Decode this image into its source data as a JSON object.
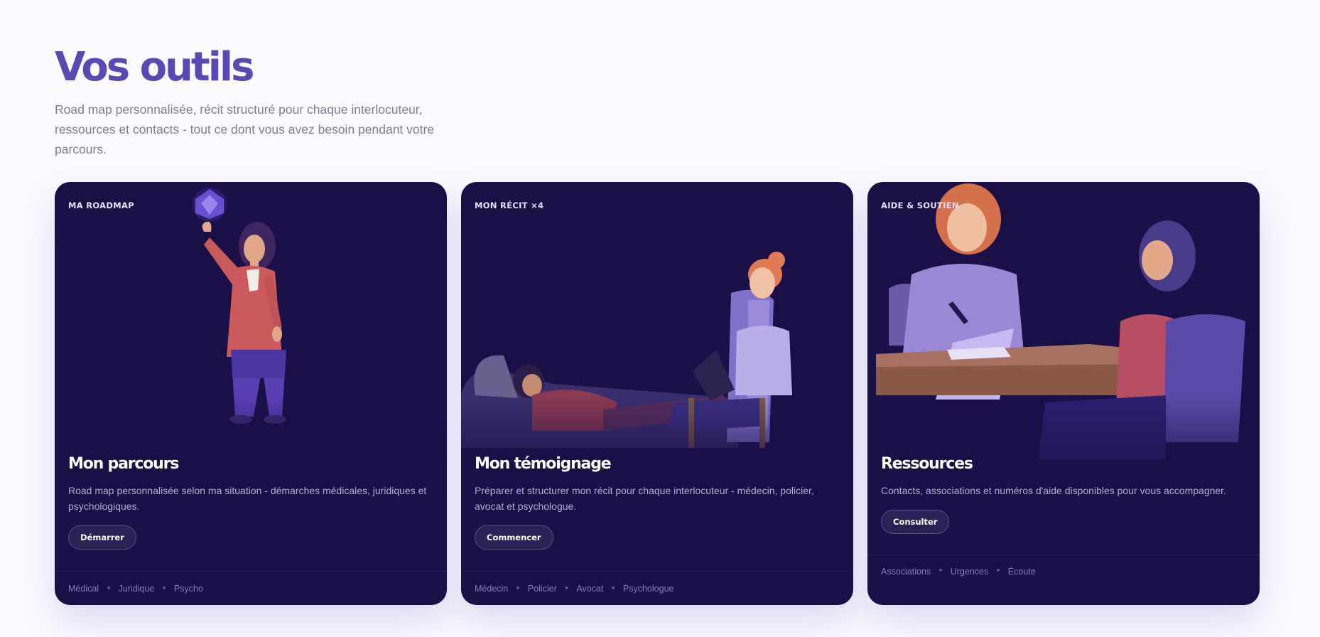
{
  "header": {
    "title": "Vos outils",
    "subtitle": "Road map personnalisée, récit structuré pour chaque interlocuteur, ressources et contacts - tout ce dont vous avez besoin pendant votre parcours."
  },
  "colors": {
    "accent": "#5a48b4",
    "card_bg": "#1a0f47",
    "page_bg": "#fbfaff"
  },
  "cards": [
    {
      "label": "MA ROADMAP",
      "title": "Mon parcours",
      "description": "Road map personnalisée selon ma situation - démarches médicales, juridiques et psychologiques.",
      "button": "Démarrer",
      "tags": [
        "Médical",
        "Juridique",
        "Psycho"
      ],
      "illustration": "woman-reaching-gem-illustration"
    },
    {
      "label": "MON RÉCIT ×4",
      "title": "Mon témoignage",
      "description": "Préparer et structurer mon récit pour chaque interlocuteur - médecin, policier, avocat et psychologue.",
      "button": "Commencer",
      "tags": [
        "Médecin",
        "Policier",
        "Avocat",
        "Psychologue"
      ],
      "illustration": "therapy-session-illustration"
    },
    {
      "label": "AIDE & SOUTIEN",
      "title": "Ressources",
      "description": "Contacts, associations et numéros d'aide disponibles pour vous accompagner.",
      "button": "Consulter",
      "tags": [
        "Associations",
        "Urgences",
        "Écoute"
      ],
      "illustration": "counseling-desk-illustration"
    }
  ],
  "tag_separator": "✦"
}
